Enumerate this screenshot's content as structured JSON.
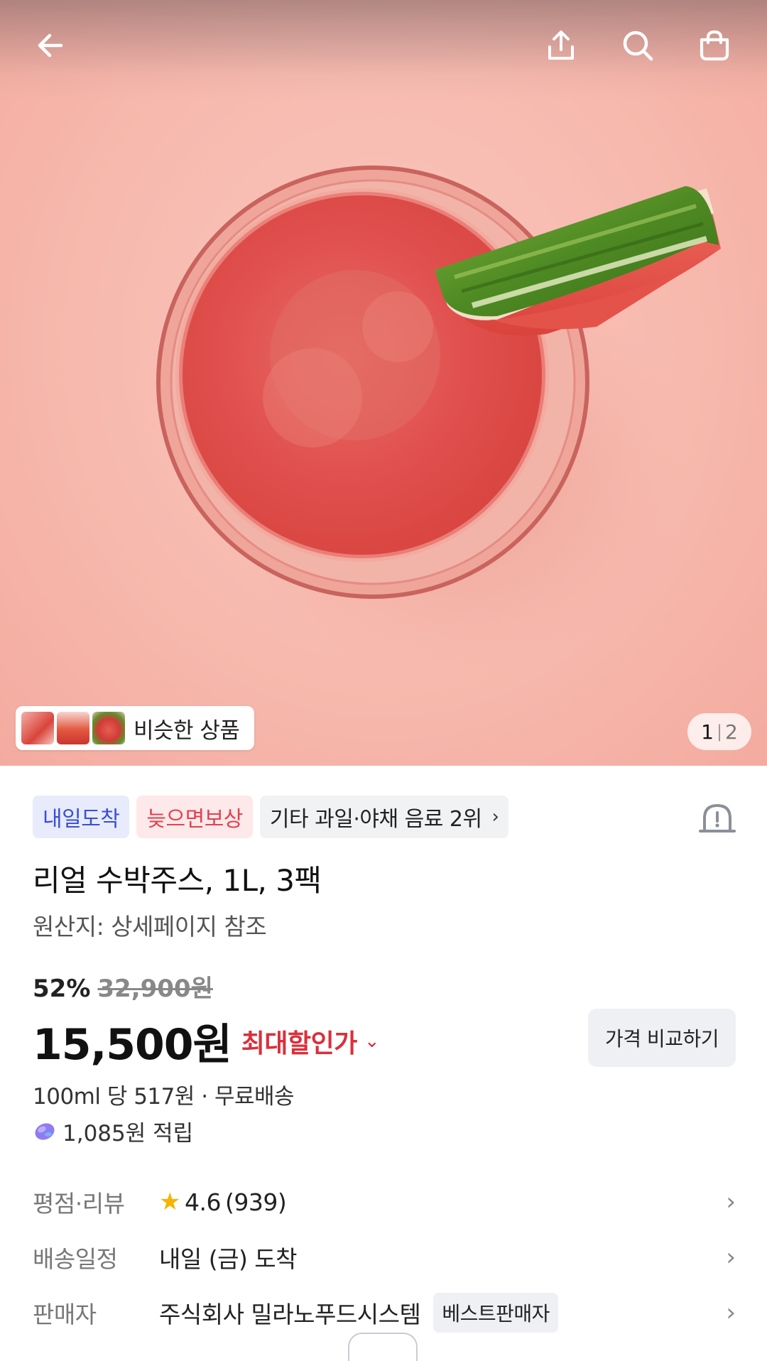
{
  "header": {
    "back_icon": "arrow-left-icon",
    "share_icon": "share-upload-icon",
    "search_icon": "search-icon",
    "cart_icon": "shopping-bag-icon"
  },
  "hero": {
    "similar_label": "비슷한 상품",
    "pager_current": "1",
    "pager_sep": "|",
    "pager_total": "2"
  },
  "badges": [
    {
      "label": "내일도착",
      "color": "#3a4fd1"
    },
    {
      "label": "늦으면보상",
      "color": "#e2414f"
    },
    {
      "label": "기타 과일·야채 음료 2위",
      "chevron": "›"
    }
  ],
  "product": {
    "title": "리얼 수박주스, 1L, 3팩",
    "origin": "원산지: 상세페이지 참조",
    "discount_pct": "52%",
    "original_price": "32,900원",
    "price": "15,500원",
    "max_discount_label": "최대할인가",
    "max_discount_chevron": "⌄",
    "compare_button": "가격 비교하기",
    "unit_price": "100ml 당 517원 · 무료배송",
    "points": "1,085원 적립"
  },
  "info_rows": [
    {
      "key": "평점·리뷰",
      "rating": "4.6",
      "reviews": "(939)"
    },
    {
      "key": "배송일정",
      "value": "내일 (금) 도착"
    },
    {
      "key": "판매자",
      "value": "주식회사 밀라노푸드시스템",
      "badge": "베스트판매자"
    }
  ],
  "colors": {
    "accent_red": "#d9303b",
    "accent_blue": "#3a4fd1",
    "star": "#f6b300"
  }
}
